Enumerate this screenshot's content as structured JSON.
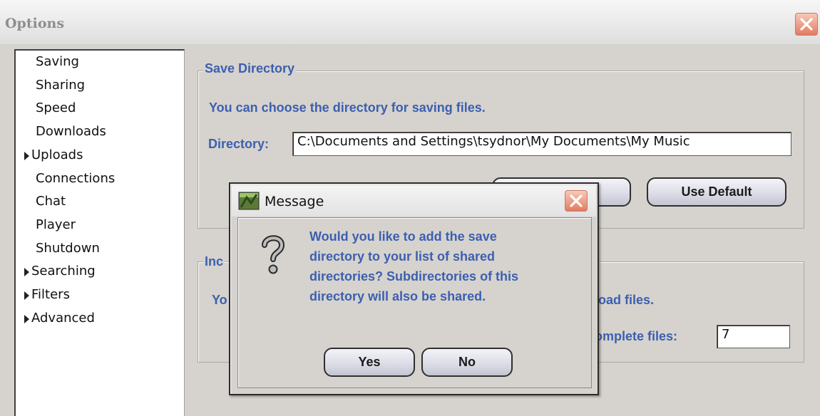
{
  "window": {
    "title": "Options"
  },
  "sidebar": {
    "items": [
      {
        "label": "Saving",
        "expandable": false
      },
      {
        "label": "Sharing",
        "expandable": false
      },
      {
        "label": "Speed",
        "expandable": false
      },
      {
        "label": "Downloads",
        "expandable": false
      },
      {
        "label": "Uploads",
        "expandable": true
      },
      {
        "label": "Connections",
        "expandable": false
      },
      {
        "label": "Chat",
        "expandable": false
      },
      {
        "label": "Player",
        "expandable": false
      },
      {
        "label": "Shutdown",
        "expandable": false
      },
      {
        "label": "Searching",
        "expandable": true
      },
      {
        "label": "Filters",
        "expandable": true
      },
      {
        "label": "Advanced",
        "expandable": true
      }
    ]
  },
  "save_directory": {
    "group_title": "Save Directory",
    "description": "You can choose the directory for saving files.",
    "directory_label": "Directory:",
    "directory_value": "C:\\Documents and Settings\\tsydnor\\My Documents\\My Music",
    "use_default_label": "Use Default"
  },
  "incomplete": {
    "group_title_partial": "Inc",
    "description_left": "Yo",
    "description_right": "load files.",
    "field_label_partial": "omplete files:",
    "field_value": "7"
  },
  "dialog": {
    "title": "Message",
    "message_lines": [
      "Would you like to add the save",
      "directory to your list of shared",
      "directories? Subdirectories of this",
      "directory will also be shared."
    ],
    "yes_label": "Yes",
    "no_label": "No"
  },
  "icons": {
    "window_close": "close-icon",
    "dialog_app": "app-icon",
    "dialog_question": "question-icon",
    "dialog_close": "close-icon"
  }
}
